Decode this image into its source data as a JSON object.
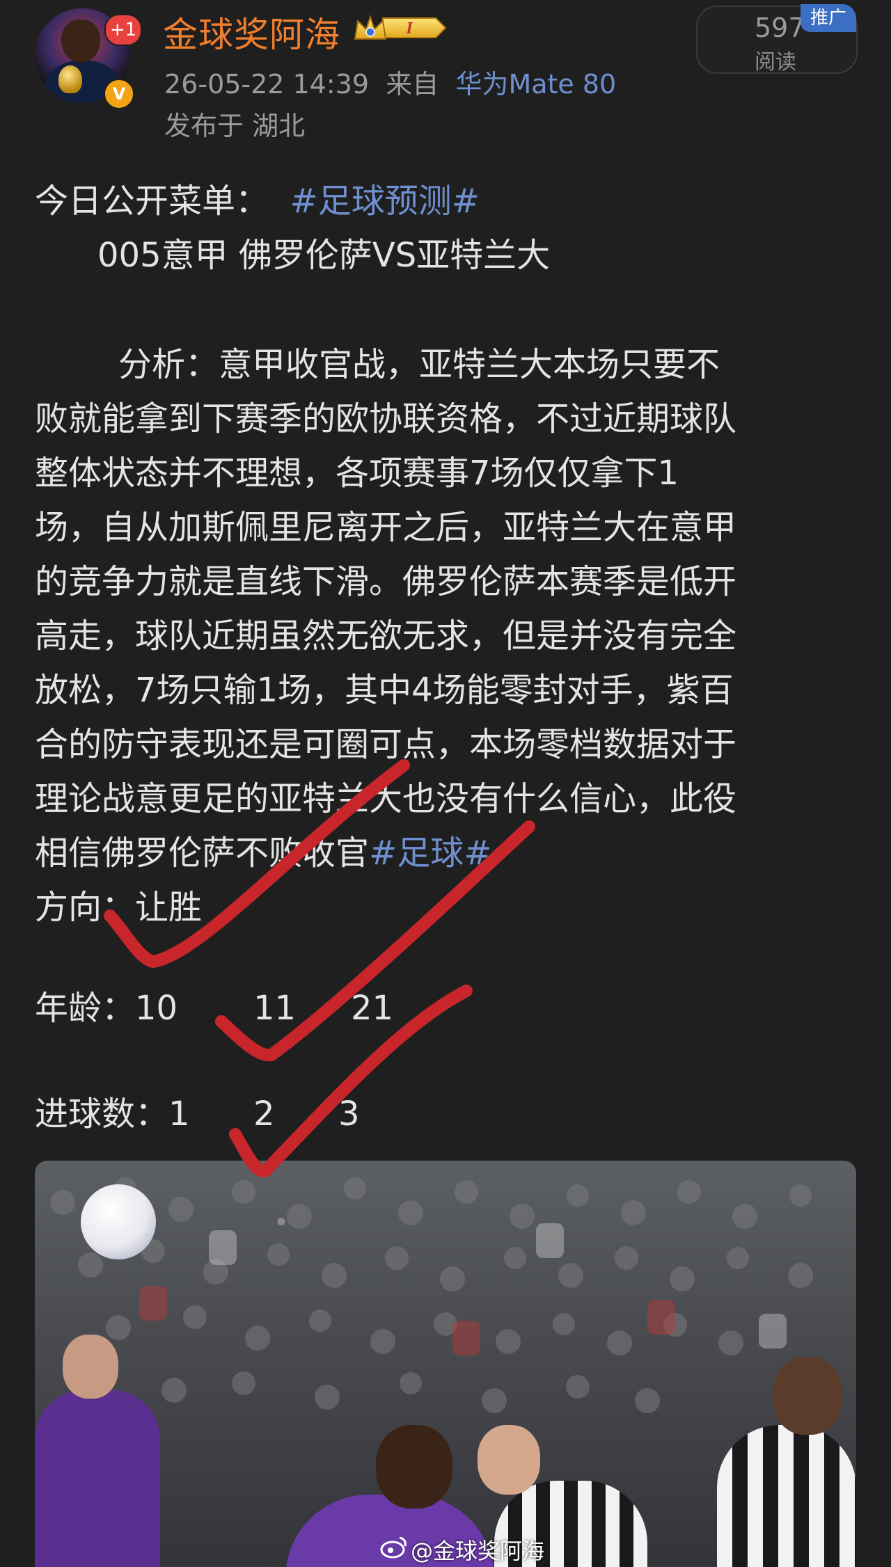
{
  "header": {
    "avatar_badge": "+1",
    "verified_mark": "V",
    "username": "金球奖阿海",
    "level_badge": "I",
    "timestamp": "26-05-22 14:39",
    "source_prefix": "来自",
    "device": "华为Mate 80",
    "location": "发布于 湖北",
    "reads_count": "597",
    "reads_label": "阅读",
    "promo_tag": "推广"
  },
  "post": {
    "menu_label": "今日公开菜单：",
    "menu_hashtag": "#足球预测#",
    "match_line": "005意甲 佛罗伦萨VS亚特兰大",
    "analysis_lines": [
      "分析：意甲收官战，亚特兰大本场只要不",
      "败就能拿到下赛季的欧协联资格，不过近期球队",
      "整体状态并不理想，各项赛事7场仅仅拿下1",
      "场，自从加斯佩里尼离开之后，亚特兰大在意甲",
      "的竞争力就是直线下滑。佛罗伦萨本赛季是低开",
      "高走，球队近期虽然无欲无求，但是并没有完全",
      "放松，7场只输1场，其中4场能零封对手，紫百",
      "合的防守表现还是可圈可点，本场零档数据对于",
      "理论战意更足的亚特兰大也没有什么信心，此役"
    ],
    "last_line_text": "相信佛罗伦萨不败收官",
    "last_line_hashtag": "#足球#",
    "direction_label": "方向：让胜",
    "age_label": "年龄：",
    "age_values": [
      "10",
      "11",
      "21"
    ],
    "goals_label": "进球数：",
    "goals_values": [
      "1",
      "2",
      "3"
    ]
  },
  "image": {
    "watermark": "@金球奖阿海"
  },
  "colors": {
    "background": "#1f1f1f",
    "username": "#f07f2e",
    "hashtag": "#6f8fd0",
    "check_marks": "#c8262b"
  }
}
